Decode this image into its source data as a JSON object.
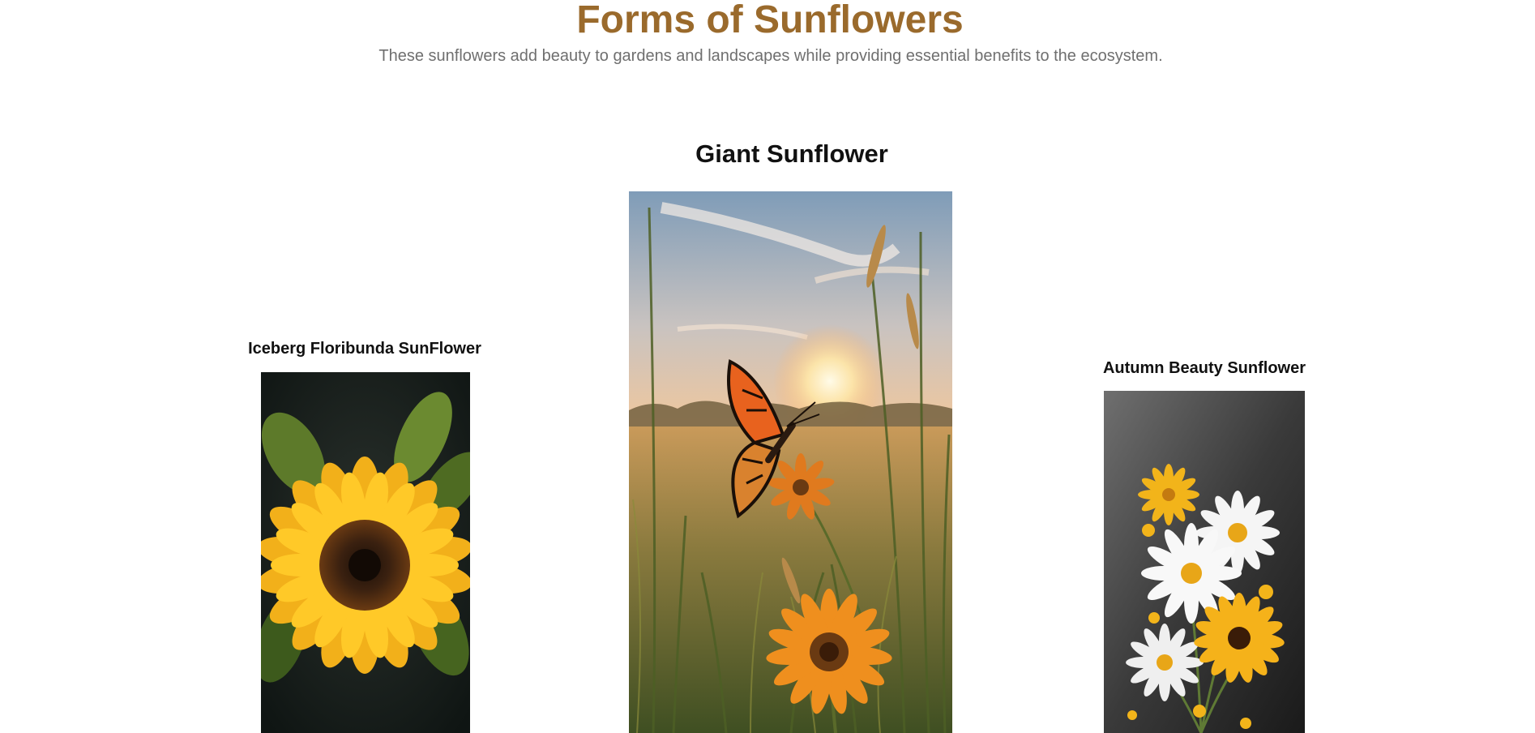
{
  "page": {
    "title": "Forms of Sunflowers",
    "subtitle": "These sunflowers add beauty to gardens and landscapes while providing essential benefits to the ecosystem."
  },
  "cards": [
    {
      "heading": "Iceberg Floribunda SunFlower",
      "image_icon": "sunflower-closeup-icon"
    },
    {
      "heading": "Giant Sunflower",
      "image_icon": "butterfly-meadow-sunset-icon"
    },
    {
      "heading": "Autumn Beauty Sunflower",
      "image_icon": "daisy-bouquet-icon"
    }
  ],
  "colors": {
    "title": "#9a6a2c",
    "subtitle": "#6f6f6f",
    "heading": "#111111",
    "background": "#ffffff"
  }
}
